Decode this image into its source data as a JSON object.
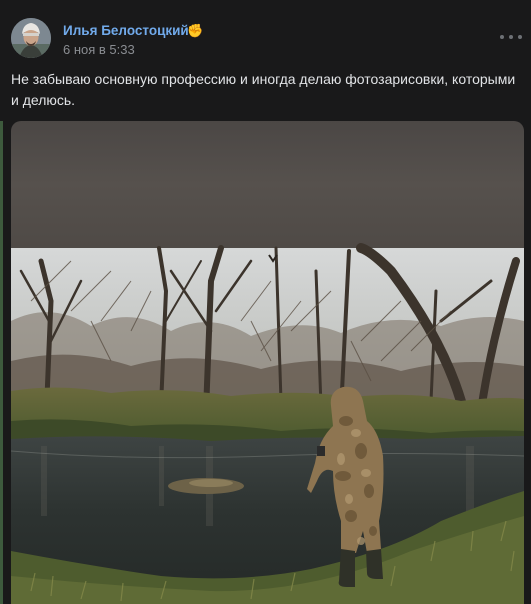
{
  "post": {
    "author_name": "Илья Белостоцкий",
    "author_badge": "✊",
    "date": "6 ноя в 5:33",
    "text": "Не забываю основную профессию и иногда делаю фотозарисовки, которыми и делюсь."
  },
  "icons": {
    "more": "more-horizontal-icon",
    "badge": "fist-emoji-icon"
  },
  "colors": {
    "background": "#19191a",
    "author_link": "#71aaeb",
    "secondary_text": "#8a8d92",
    "primary_text": "#e1e3e6"
  }
}
